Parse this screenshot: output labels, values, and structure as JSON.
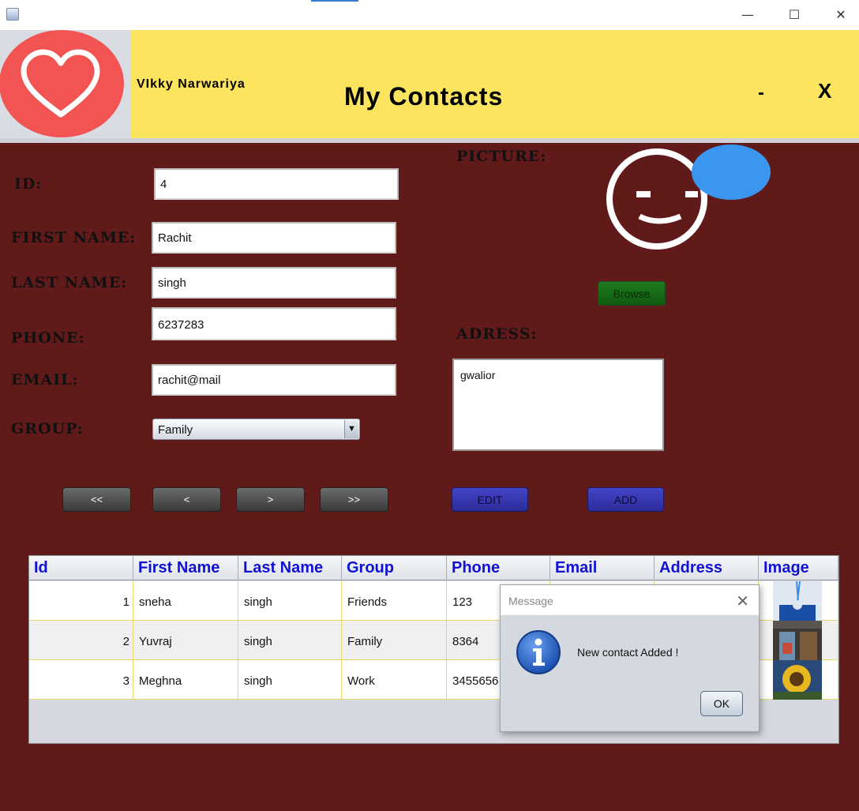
{
  "window": {
    "minimize_glyph": "—",
    "maximize_glyph": "☐",
    "close_glyph": "✕"
  },
  "header": {
    "user_name": "VIkky Narwariya",
    "title": "My Contacts",
    "minimize_label": "-",
    "close_label": "X",
    "logo_icon": "heart-icon"
  },
  "form": {
    "id_label": "ID:",
    "id_value": "4",
    "first_name_label": "First Name:",
    "first_name_value": "Rachit",
    "last_name_label": "Last Name:",
    "last_name_value": "singh",
    "phone_label": "Phone:",
    "phone_value": "6237283",
    "email_label": "Email:",
    "email_value": "rachit@mail",
    "group_label": "Group:",
    "group_value": "Family",
    "picture_label": "Picture:",
    "address_label": "Adress:",
    "address_value": "gwalior",
    "browse_label": "Browse"
  },
  "nav_buttons": {
    "first": "<<",
    "prev": "<",
    "next": ">",
    "last": ">>"
  },
  "action_buttons": {
    "edit": "EDIT",
    "add": "ADD"
  },
  "colors": {
    "background": "#611a1a",
    "header": "#fde45f",
    "header_text": "#1111d6",
    "grid_line": "#e6d86a"
  },
  "table": {
    "columns": [
      "Id",
      "First Name",
      "Last Name",
      "Group",
      "Phone",
      "Email",
      "Address",
      "Image"
    ],
    "rows": [
      {
        "id": "1",
        "first": "sneha",
        "last": "singh",
        "group": "Friends",
        "phone": "123"
      },
      {
        "id": "2",
        "first": "Yuvraj",
        "last": "singh",
        "group": "Family",
        "phone": "8364"
      },
      {
        "id": "3",
        "first": "Meghna",
        "last": "singh",
        "group": "Work",
        "phone": "3455656"
      }
    ]
  },
  "dialog": {
    "title": "Message",
    "message": "New contact Added !",
    "ok_label": "OK",
    "close_glyph": "✕",
    "icon": "info-icon"
  }
}
